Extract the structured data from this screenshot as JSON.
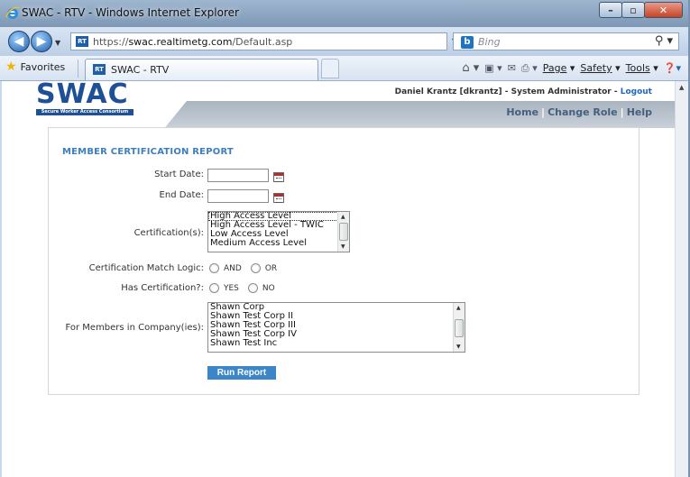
{
  "browser": {
    "window_title": "SWAC - RTV - Windows Internet Explorer",
    "url_prefix": "https://",
    "url_host": "swac.realtimetg.com",
    "url_path": "/Default.asp",
    "search_placeholder": "Bing",
    "favorites_label": "Favorites",
    "tab_label": "SWAC - RTV",
    "favicon_text": "RT",
    "commands": {
      "page": "Page",
      "safety": "Safety",
      "tools": "Tools"
    }
  },
  "site": {
    "logo_text": "SWAC",
    "logo_tagline": "Secure Worker Access Consortium",
    "user_info": "Daniel Krantz [dkrantz] - System Administrator - ",
    "logout_label": "Logout",
    "nav": {
      "home": "Home",
      "change_role": "Change Role",
      "help": "Help"
    }
  },
  "report": {
    "title": "MEMBER CERTIFICATION REPORT",
    "start_date_label": "Start Date:",
    "start_date_value": "",
    "end_date_label": "End Date:",
    "end_date_value": "",
    "certifications_label": "Certification(s):",
    "certifications": [
      "High Access Level",
      "High Access Level - TWIC",
      "Low Access Level",
      "Medium Access Level"
    ],
    "match_logic_label": "Certification Match Logic:",
    "match_logic_options": [
      "AND",
      "OR"
    ],
    "has_cert_label": "Has Certification?:",
    "has_cert_options": [
      "YES",
      "NO"
    ],
    "companies_label": "For Members in Company(ies):",
    "companies": [
      "Shawn Corp",
      "Shawn Test Corp II",
      "Shawn Test Corp III",
      "Shawn Test Corp IV",
      "Shawn Test Inc"
    ],
    "run_button": "Run Report"
  }
}
